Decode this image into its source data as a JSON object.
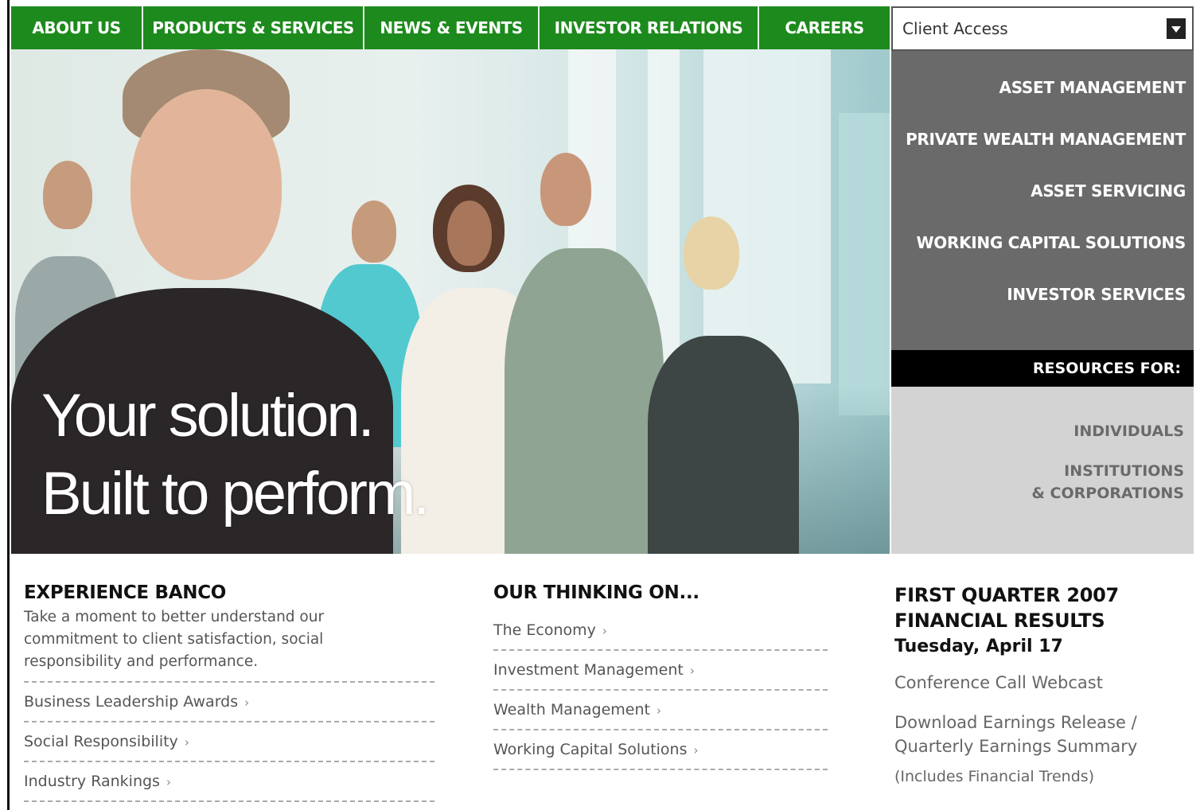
{
  "nav": {
    "items": [
      {
        "label": "ABOUT US"
      },
      {
        "label": "PRODUCTS & SERVICES"
      },
      {
        "label": "NEWS & EVENTS"
      },
      {
        "label": "INVESTOR RELATIONS"
      },
      {
        "label": "CAREERS"
      }
    ],
    "client_access": "Client Access"
  },
  "hero": {
    "line1": "Your solution.",
    "line2": "Built to perform."
  },
  "side_menu": {
    "items": [
      {
        "label": "ASSET MANAGEMENT"
      },
      {
        "label": "PRIVATE WEALTH MANAGEMENT"
      },
      {
        "label": "ASSET SERVICING"
      },
      {
        "label": "WORKING CAPITAL SOLUTIONS"
      },
      {
        "label": "INVESTOR SERVICES"
      }
    ],
    "resources_header": "RESOURCES FOR:",
    "resources": [
      {
        "label": "INDIVIDUALS"
      },
      {
        "label": "INSTITUTIONS\n& CORPORATIONS"
      }
    ]
  },
  "experience": {
    "title": "EXPERIENCE BANCO",
    "body": "Take a moment to better understand our commitment to client satisfaction, social responsibility and performance.",
    "links": [
      {
        "label": "Business Leadership Awards"
      },
      {
        "label": "Social Responsibility"
      },
      {
        "label": "Industry Rankings"
      }
    ]
  },
  "thinking": {
    "title": "OUR THINKING ON...",
    "links": [
      {
        "label": "The Economy"
      },
      {
        "label": "Investment Management"
      },
      {
        "label": "Wealth Management"
      },
      {
        "label": "Working Capital Solutions"
      }
    ]
  },
  "financial": {
    "title_line1": "FIRST QUARTER 2007",
    "title_line2": "FINANCIAL RESULTS",
    "date": "Tuesday, April 17",
    "webcast": "Conference Call Webcast",
    "download": "Download Earnings Release / Quarterly Earnings Summary",
    "note": "(Includes Financial Trends)"
  },
  "colors": {
    "nav_green": "#1d8a1d",
    "menu_gray": "#6a6a6a",
    "resources_gray": "#d3d3d3"
  }
}
